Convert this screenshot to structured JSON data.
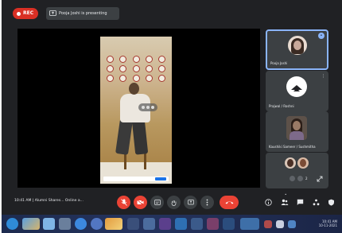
{
  "topbar": {
    "rec_label": "REC",
    "presenting_text": "Pooja Joshi is presenting"
  },
  "participants": [
    {
      "name": "Pooja Joshi",
      "color": "#c9a99a"
    },
    {
      "name": "Prajwal / Roshni",
      "color": "#ffffff"
    },
    {
      "name": "Kaushiki Sameer / Sushmitha",
      "color": "#9a7a66"
    }
  ],
  "grid_tile": {
    "more_count": "2"
  },
  "bottombar": {
    "meeting_info": "10:41 AM | Alumni Shares... Online a..."
  },
  "taskbar": {
    "clock": "10:41 AM\n10-11-2021"
  },
  "colors": {
    "accent": "#8ab4f8",
    "danger": "#ea4335",
    "surface": "#3c4043"
  }
}
